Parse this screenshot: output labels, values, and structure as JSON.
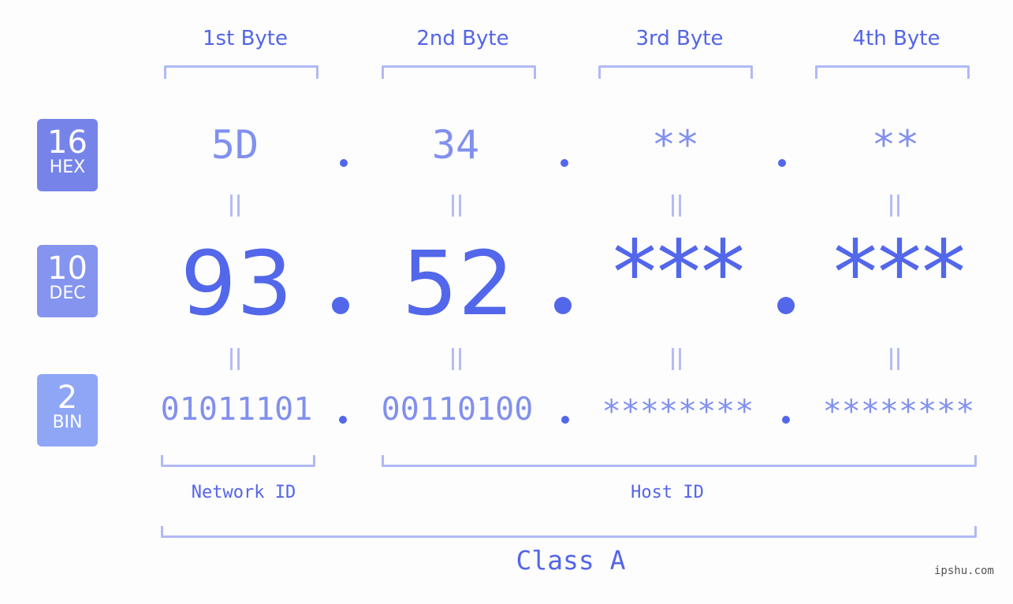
{
  "byte_headers": [
    "1st Byte",
    "2nd Byte",
    "3rd Byte",
    "4th Byte"
  ],
  "badges": [
    {
      "base": "16",
      "label": "HEX",
      "color": "#7684ea"
    },
    {
      "base": "10",
      "label": "DEC",
      "color": "#8494ef"
    },
    {
      "base": "2",
      "label": "BIN",
      "color": "#8fa6f6"
    }
  ],
  "hex": [
    "5D",
    "34",
    "**",
    "**"
  ],
  "dec": [
    "93",
    "52",
    "***",
    "***"
  ],
  "bin": [
    "01011101",
    "00110100",
    "********",
    "********"
  ],
  "network_id_label": "Network ID",
  "host_id_label": "Host ID",
  "class_label": "Class A",
  "watermark": "ipshu.com"
}
